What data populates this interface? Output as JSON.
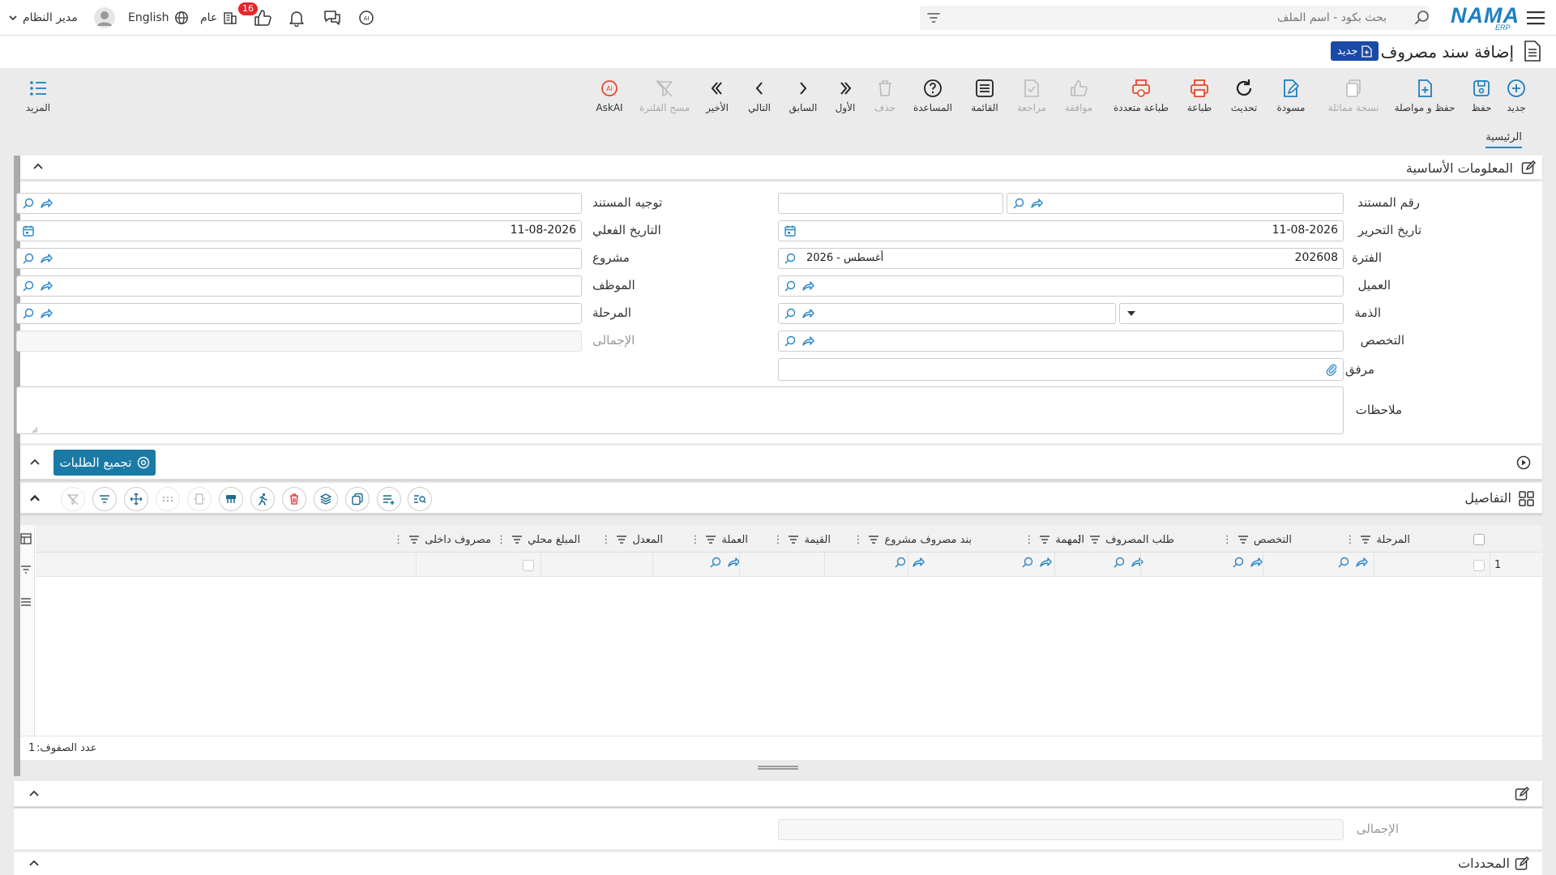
{
  "topbar": {
    "search_placeholder": "بحث بكود - اسم الملف",
    "brand": "NAMA",
    "brand_sub": "ERP",
    "user_name": "مدير النظام",
    "language": "English",
    "branch": "عام",
    "notifications_count": "16"
  },
  "page": {
    "title": "إضافة سند مصروف",
    "status_badge": "جديد"
  },
  "toolbar": {
    "new": "جديد",
    "save": "حفظ",
    "save_continue": "حفظ و مواصلة",
    "copy": "نسخة مماثلة",
    "draft": "مسودة",
    "refresh": "تحديث",
    "print": "طباعة",
    "multi_print": "طباعة متعددة",
    "approve": "موافقة",
    "review": "مراجعة",
    "list": "القائمة",
    "help": "المساعدة",
    "delete": "حذف",
    "first": "الأول",
    "previous": "السابق",
    "next": "التالي",
    "last": "الأخير",
    "clear_filter": "مسح الفلترة",
    "ask_ai": "AskAI",
    "more": "المزيد"
  },
  "tabs": {
    "main": "الرئيسية"
  },
  "basic_info": {
    "title": "المعلومات الأساسية",
    "doc_number_label": "رقم المستند",
    "doc_direction_label": "توجيه المستند",
    "edit_date_label": "تاريخ التحرير",
    "edit_date_value": "11-08-2026",
    "actual_date_label": "التاريخ الفعلي",
    "actual_date_value": "11-08-2026",
    "period_label": "الفترة",
    "period_value": "202608",
    "period_name": "2026 - أغسطس",
    "project_label": "مشروع",
    "customer_label": "العميل",
    "employee_label": "الموظف",
    "liability_label": "الذمة",
    "stage_label": "المرحلة",
    "specialty_label": "التخصص",
    "total_label": "الإجمالى",
    "attachment_label": "مرفق",
    "notes_label": "ملاحظات"
  },
  "collect_requests": {
    "button": "تجميع الطلبات"
  },
  "details": {
    "title": "التفاصيل",
    "columns": [
      "المرحلة",
      "التخصص",
      "طلب المصروف",
      "المهمة",
      "بند مصروف مشروع",
      "القيمة",
      "العملة",
      "المعدل",
      "المبلغ محلي",
      "مصروف داخلى"
    ],
    "row_number": "1",
    "row_count_label": "عدد الصفوف:",
    "row_count_value": "1"
  },
  "totals_panel": {
    "total_label": "الإجمالى"
  },
  "selectors_panel": {
    "title": "المحددات"
  }
}
